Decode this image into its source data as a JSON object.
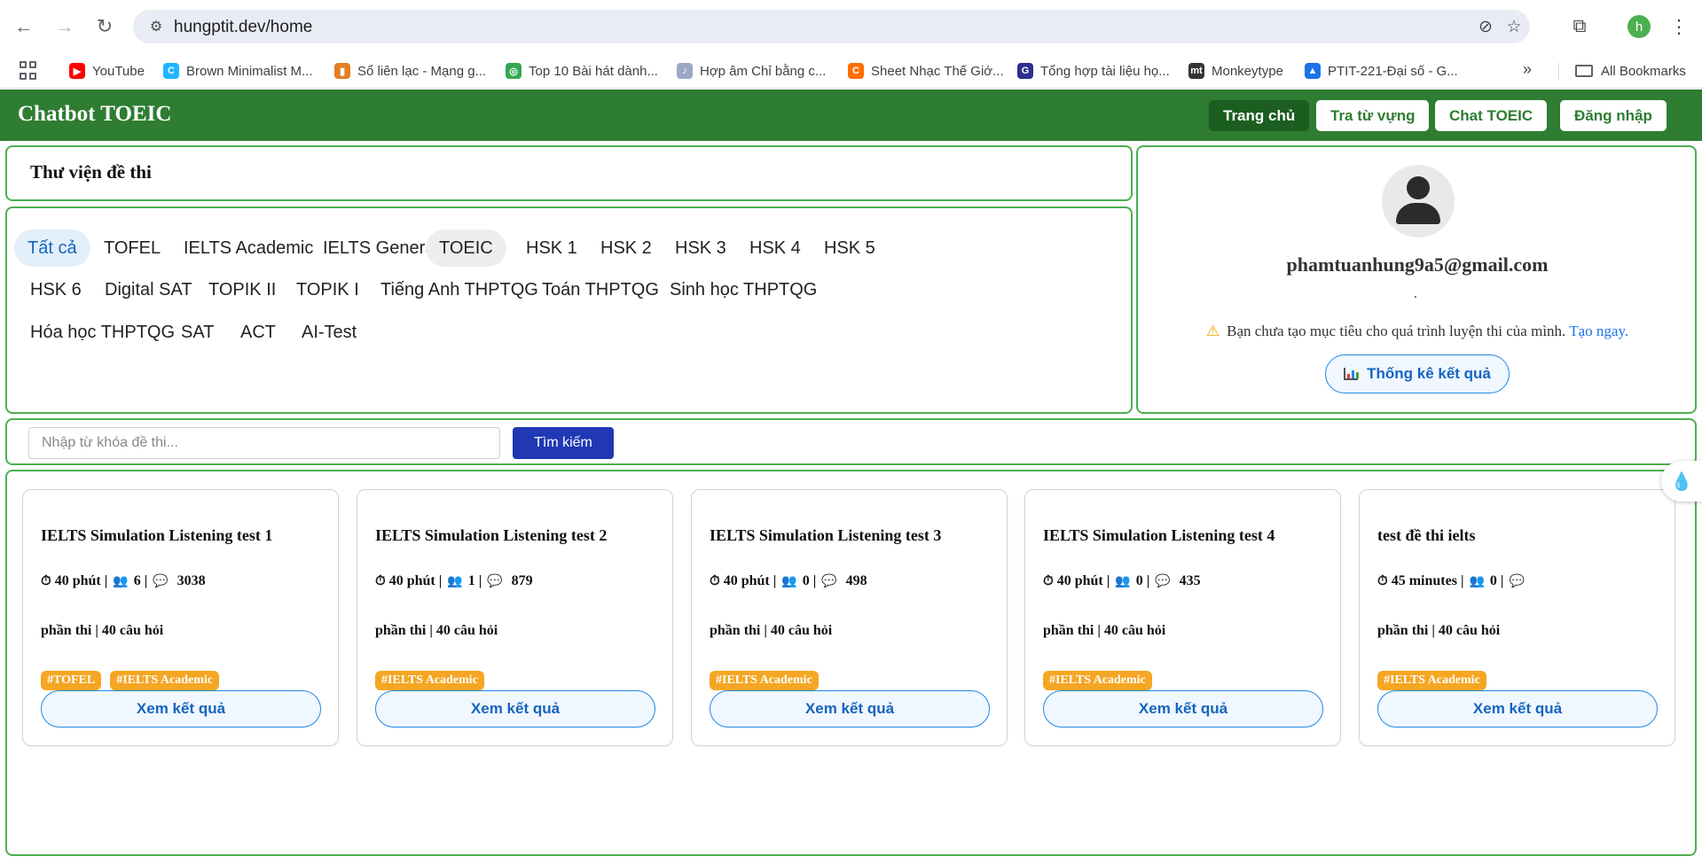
{
  "browser": {
    "url": "hungptit.dev/home",
    "profile_initial": "h",
    "bookmarks": [
      {
        "label": "YouTube",
        "icon": "youtube-icon",
        "color": "#ff0000",
        "glyph": "▶"
      },
      {
        "label": "Brown Minimalist M...",
        "icon": "canva-icon",
        "color": "#1fb6ff",
        "glyph": "C"
      },
      {
        "label": "Sổ liên lạc - Mạng g...",
        "icon": "chart-icon",
        "color": "#e67e22",
        "glyph": "▮"
      },
      {
        "label": "Top 10 Bài hát dành...",
        "icon": "chrome-icon",
        "color": "#34a853",
        "glyph": "◎"
      },
      {
        "label": "Hợp âm Chỉ bằng c...",
        "icon": "guitar-icon",
        "color": "#9aa8c4",
        "glyph": "♪"
      },
      {
        "label": "Sheet Nhạc Thế Giớ...",
        "icon": "sheet-music-icon",
        "color": "#ff6f00",
        "glyph": "C"
      },
      {
        "label": "Tổng hợp tài liệu họ...",
        "icon": "doc-site-icon",
        "color": "#2c2f8f",
        "glyph": "G"
      },
      {
        "label": "Monkeytype",
        "icon": "monkeytype-icon",
        "color": "#323437",
        "glyph": "mt"
      },
      {
        "label": "PTIT-221-Đại số - G...",
        "icon": "google-drive-icon",
        "color": "#1a73e8",
        "glyph": "▲"
      }
    ],
    "overflow": "»",
    "all_bookmarks": "All Bookmarks"
  },
  "header": {
    "brand": "Chatbot TOEIC",
    "nav": [
      "Trang chủ",
      "Tra từ vựng",
      "Chat TOEIC",
      "Đăng nhập"
    ],
    "active_nav": "Trang chủ"
  },
  "library": {
    "title": "Thư viện đề thi",
    "categories": [
      "Tất cả",
      "TOFEL",
      "IELTS Academic",
      "IELTS General",
      "TOEIC",
      "HSK 1",
      "HSK 2",
      "HSK 3",
      "HSK 4",
      "HSK 5",
      "HSK 6",
      "Digital SAT",
      "TOPIK II",
      "TOPIK I",
      "Tiếng Anh THPTQG",
      "Toán THPTQG",
      "Sinh học THPTQG",
      "Hóa học THPTQG",
      "SAT",
      "ACT",
      "AI-Test"
    ],
    "selected_category": "Tất cả",
    "hovered_category": "TOEIC"
  },
  "profile": {
    "email": "phamtuanhung9a5@gmail.com",
    "goal_message": "Bạn chưa tạo mục tiêu cho quá trình luyện thi của mình.",
    "goal_link": "Tạo ngay.",
    "stats_button": "Thống kê kết quả"
  },
  "search": {
    "placeholder": "Nhập từ khóa đề thi...",
    "button": "Tìm kiếm"
  },
  "tests": [
    {
      "title": "IELTS Simulation Listening test 1",
      "duration": "40 phút",
      "participants": "6",
      "comments": "3038",
      "sub": "phần thi | 40 câu hỏi",
      "tags": [
        "#TOFEL",
        "#IELTS Academic"
      ],
      "button": "Xem kết quả"
    },
    {
      "title": "IELTS Simulation Listening test 2",
      "duration": "40 phút",
      "participants": "1",
      "comments": "879",
      "sub": "phần thi | 40 câu hỏi",
      "tags": [
        "#IELTS Academic"
      ],
      "button": "Xem kết quả"
    },
    {
      "title": "IELTS Simulation Listening test 3",
      "duration": "40 phút",
      "participants": "0",
      "comments": "498",
      "sub": "phần thi | 40 câu hỏi",
      "tags": [
        "#IELTS Academic"
      ],
      "button": "Xem kết quả"
    },
    {
      "title": "IELTS Simulation Listening test 4",
      "duration": "40 phút",
      "participants": "0",
      "comments": "435",
      "sub": "phần thi | 40 câu hỏi",
      "tags": [
        "#IELTS Academic"
      ],
      "button": "Xem kết quả"
    },
    {
      "title": "test đề thi ielts",
      "duration": "45 minutes",
      "participants": "0",
      "comments": "",
      "sub": "phần thi | 40 câu hỏi",
      "tags": [
        "#IELTS Academic"
      ],
      "button": "Xem kết quả"
    }
  ],
  "colors": {
    "brand_green": "#2e7d32",
    "border_green": "#4caf50",
    "tag_orange": "#f5a623",
    "button_blue": "#1e88e5",
    "search_blue": "#2038b4"
  }
}
